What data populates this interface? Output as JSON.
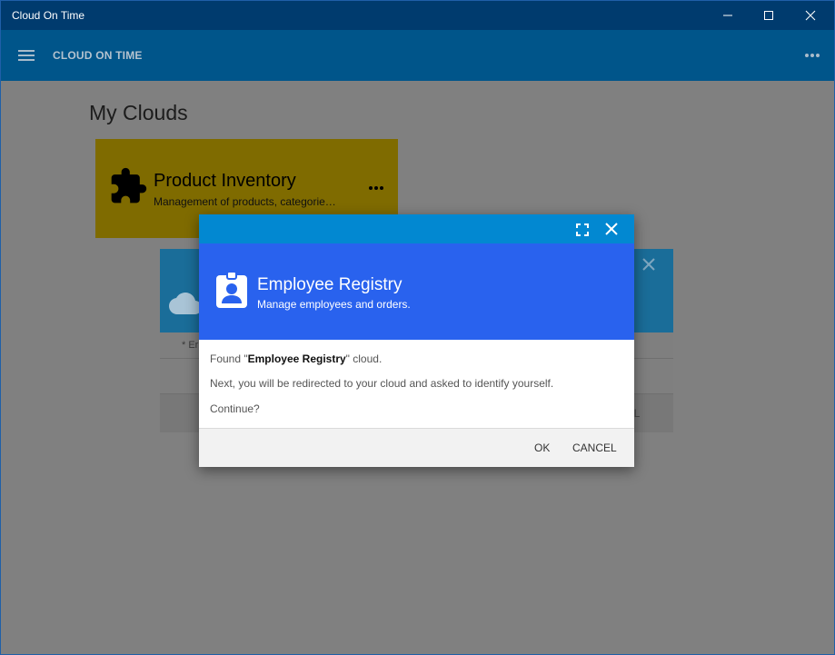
{
  "window": {
    "title": "Cloud On Time",
    "controls": [
      "minimize-icon",
      "maximize-icon",
      "close-icon"
    ]
  },
  "appbar": {
    "menu_icon": "hamburger-icon",
    "app_name": "CLOUD ON TIME",
    "more_icon": "more-icon"
  },
  "page": {
    "title": "My Clouds"
  },
  "tile": {
    "icon": "puzzle-icon",
    "title": "Product Inventory",
    "description": "Management of products, categorie…",
    "more_icon": "more-icon",
    "color": "#7f6b00"
  },
  "back_dialog": {
    "note_prefix": "* Er",
    "cancel_fragment": "CEL",
    "cloud_icon": "cloud-icon",
    "close_icon": "close-icon"
  },
  "dialog": {
    "expand_icon": "fullscreen-icon",
    "close_icon": "close-icon",
    "badge_icon": "id-badge-icon",
    "title": "Employee Registry",
    "subtitle": "Manage employees and orders.",
    "found_prefix": "Found \"",
    "found_name": "Employee Registry",
    "found_suffix": "\" cloud.",
    "message": "Next, you will be redirected to your cloud and asked to identify yourself.",
    "question": "Continue?",
    "ok_label": "OK",
    "cancel_label": "CANCEL",
    "bar_color": "#0288d1",
    "header_color": "#2962ee"
  }
}
